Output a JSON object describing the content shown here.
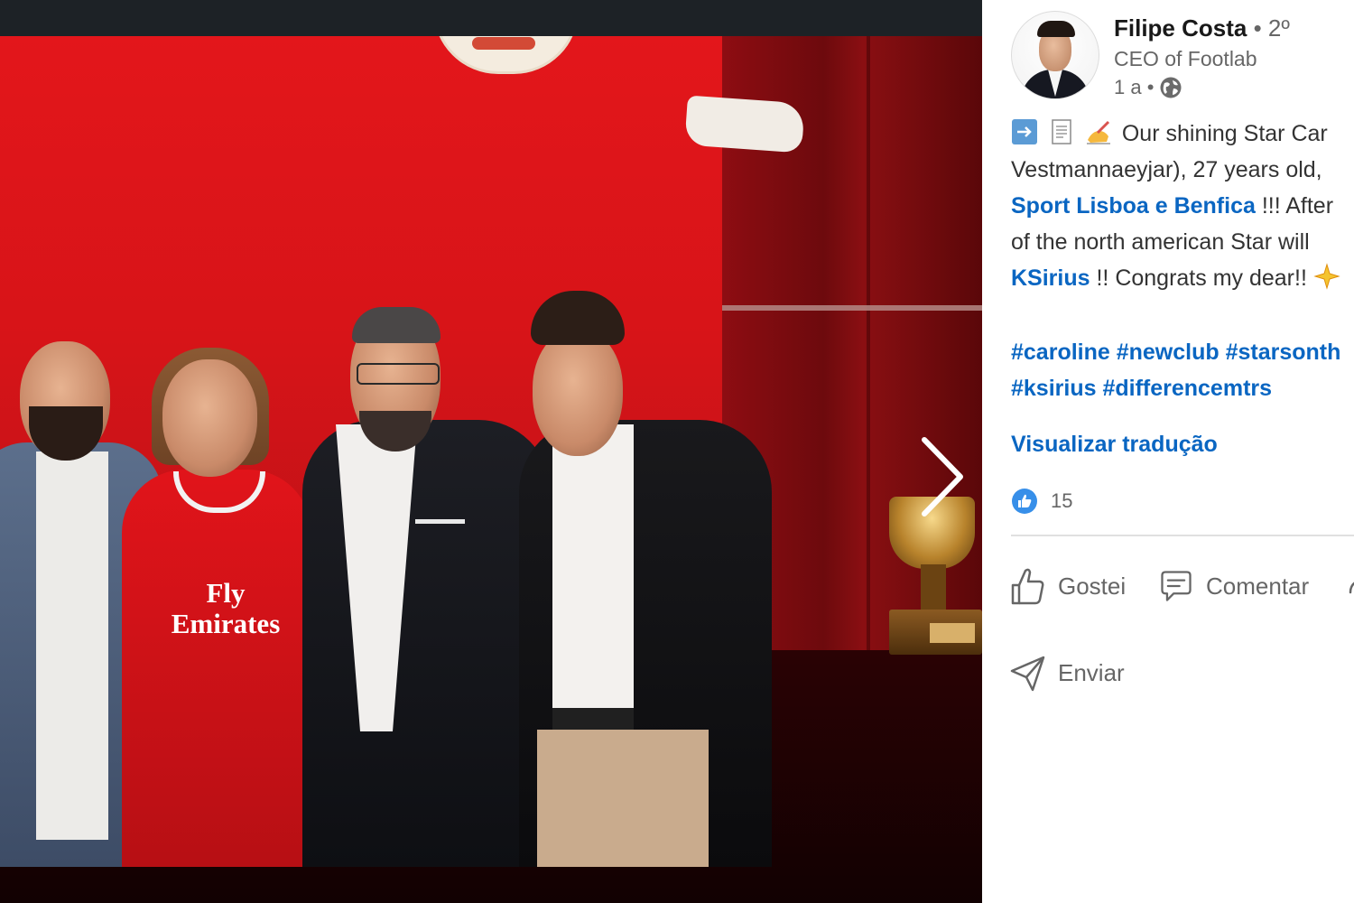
{
  "photo": {
    "sponsor_line1": "Fly",
    "sponsor_line2": "Emirates"
  },
  "post": {
    "author": {
      "name": "Filipe Costa",
      "degree": "• 2º",
      "headline": "CEO of Footlab",
      "time": "1 a •"
    },
    "text_lines": [
      {
        "emoji": [
          "arrow-right-icon",
          "page-icon",
          "writing-hand-icon"
        ],
        "text": "Our shining Star Car"
      },
      {
        "text": "Vestmannaeyjar), 27 years old,"
      },
      {
        "link": "Sport Lisboa e Benfica",
        "text": " !!! After"
      },
      {
        "text": "of the north american Star will"
      },
      {
        "link": "KSirius",
        "text": " !! Congrats my dear!!"
      }
    ],
    "hashtags_line1": "#caroline #newclub #starsonth",
    "hashtags_line2": "#ksirius #differencemtrs",
    "translate_label": "Visualizar tradução",
    "reaction_count": "15"
  },
  "actions": {
    "like": "Gostei",
    "comment": "Comentar",
    "send": "Enviar"
  },
  "colors": {
    "link": "#0a66c2",
    "muted": "#666666",
    "viewer_bg": "#1d2226"
  }
}
